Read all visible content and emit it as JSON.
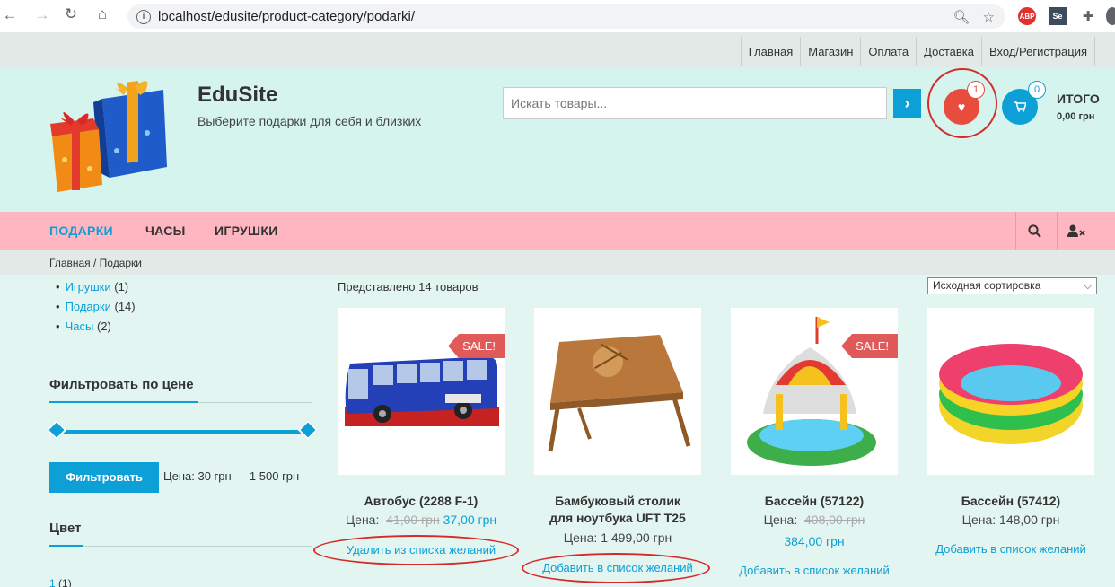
{
  "browser": {
    "url": "localhost/edusite/product-category/podarki/",
    "ext_abp": "ABP",
    "ext_se": "Se"
  },
  "topnav": [
    "Главная",
    "Магазин",
    "Оплата",
    "Доставка",
    "Вход/Регистрация"
  ],
  "site": {
    "title": "EduSite",
    "description": "Выберите подарки для себя и близких"
  },
  "search": {
    "placeholder": "Искать товары..."
  },
  "wishlist": {
    "count": "1"
  },
  "cart": {
    "count": "0",
    "total_label": "ИТОГО",
    "total_value": "0,00 грн"
  },
  "mainnav": [
    "ПОДАРКИ",
    "ЧАСЫ",
    "ИГРУШКИ"
  ],
  "breadcrumb": "Главная / Подарки",
  "categories": [
    {
      "name": "Игрушки",
      "count": "(1)"
    },
    {
      "name": "Подарки",
      "count": "(14)"
    },
    {
      "name": "Часы",
      "count": "(2)"
    }
  ],
  "filter": {
    "title": "Фильтровать по цене",
    "button": "Фильтровать",
    "range": "Цена: 30 грн — 1 500 грн"
  },
  "color_widget": {
    "title": "Цвет",
    "item_name": "1",
    "item_count": "(1)"
  },
  "listing": {
    "result_count": "Представлено 14 товаров",
    "sort": "Исходная сортировка"
  },
  "sale_label": "SALE!",
  "price_label": "Цена:",
  "products": [
    {
      "title": "Автобус (2288 F-1)",
      "old_price": "41,00 грн",
      "price": "37,00 грн",
      "wish": "Удалить из списка желаний"
    },
    {
      "title_line1": "Бамбуковый столик",
      "title_line2": "для ноутбука UFT T25",
      "price": "1 499,00 грн",
      "wish": "Добавить в список желаний"
    },
    {
      "title": "Бассейн (57122)",
      "old_price": "408,00 грн",
      "price": "384,00 грн",
      "wish": "Добавить в список желаний"
    },
    {
      "title": "Бассейн (57412)",
      "price": "148,00 грн",
      "wish": "Добавить в список желаний"
    }
  ],
  "colors": {
    "accent": "#0ca0d6",
    "header_bg": "#d5f4ee",
    "nav_bg": "#ffb6c1",
    "sale": "#e05a5a",
    "annotation": "#d62a2a"
  }
}
